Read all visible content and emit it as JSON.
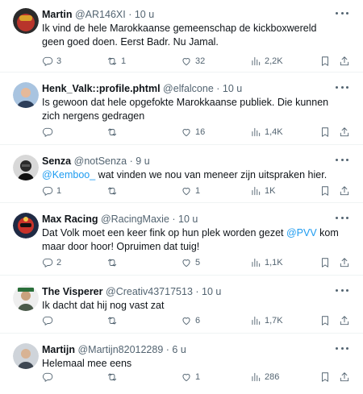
{
  "tweets": [
    {
      "name": "Martin",
      "handle": "@AR146XI",
      "dot": "·",
      "time": "10 u",
      "text": "Ik vind de hele Marokkaanse gemeenschap de kickboxwereld geen goed doen. Eerst Badr. Nu Jamal.",
      "replies": "3",
      "retweets": "1",
      "likes": "32",
      "views": "2,2K",
      "avatar_color": "#b8342b"
    },
    {
      "name": "Henk_Valk::profile.phtml",
      "handle": "@elfalcone",
      "dot": "·",
      "time": "10 u",
      "text": "Is gewoon dat hele opgefokte  Marokkaanse publiek. Die kunnen zich nergens gedragen",
      "replies": "",
      "retweets": "",
      "likes": "16",
      "views": "1,4K",
      "avatar_color": "#6b8db5"
    },
    {
      "name": "Senza",
      "handle": "@notSenza",
      "dot": "·",
      "time": "9 u",
      "text_mention": "@Kemboo_",
      "text": " wat vinden we nou van meneer zijn uitspraken hier.",
      "replies": "1",
      "retweets": "",
      "likes": "1",
      "views": "1K",
      "avatar_color": "#3a3a3a"
    },
    {
      "name": "Max Racing",
      "handle": "@RacingMaxie",
      "dot": "·",
      "time": "10 u",
      "text_before": "Dat Volk moet een keer fink op hun plek worden gezet ",
      "text_mention": "@PVV",
      "text_after": " kom maar door hoor! Opruimen dat tuig!",
      "replies": "2",
      "retweets": "",
      "likes": "5",
      "views": "1,1K",
      "avatar_color": "#1f2a44"
    },
    {
      "name": "The Visperer",
      "handle": "@Creativ43717513",
      "dot": "·",
      "time": "10 u",
      "text": "Ik dacht dat hij nog vast zat",
      "replies": "",
      "retweets": "",
      "likes": "6",
      "views": "1,7K",
      "avatar_color": "#7a8a7a"
    },
    {
      "name": "Martijn",
      "handle": "@Martijn82012289",
      "dot": "·",
      "time": "6 u",
      "text": "Helemaal mee eens",
      "replies": "",
      "retweets": "",
      "likes": "1",
      "views": "286",
      "avatar_color": "#5b6470"
    }
  ],
  "icons": {
    "reply": "reply-icon",
    "retweet": "retweet-icon",
    "like": "heart-icon",
    "views": "views-icon",
    "bookmark": "bookmark-icon",
    "share": "share-icon",
    "more": "more-icon"
  }
}
